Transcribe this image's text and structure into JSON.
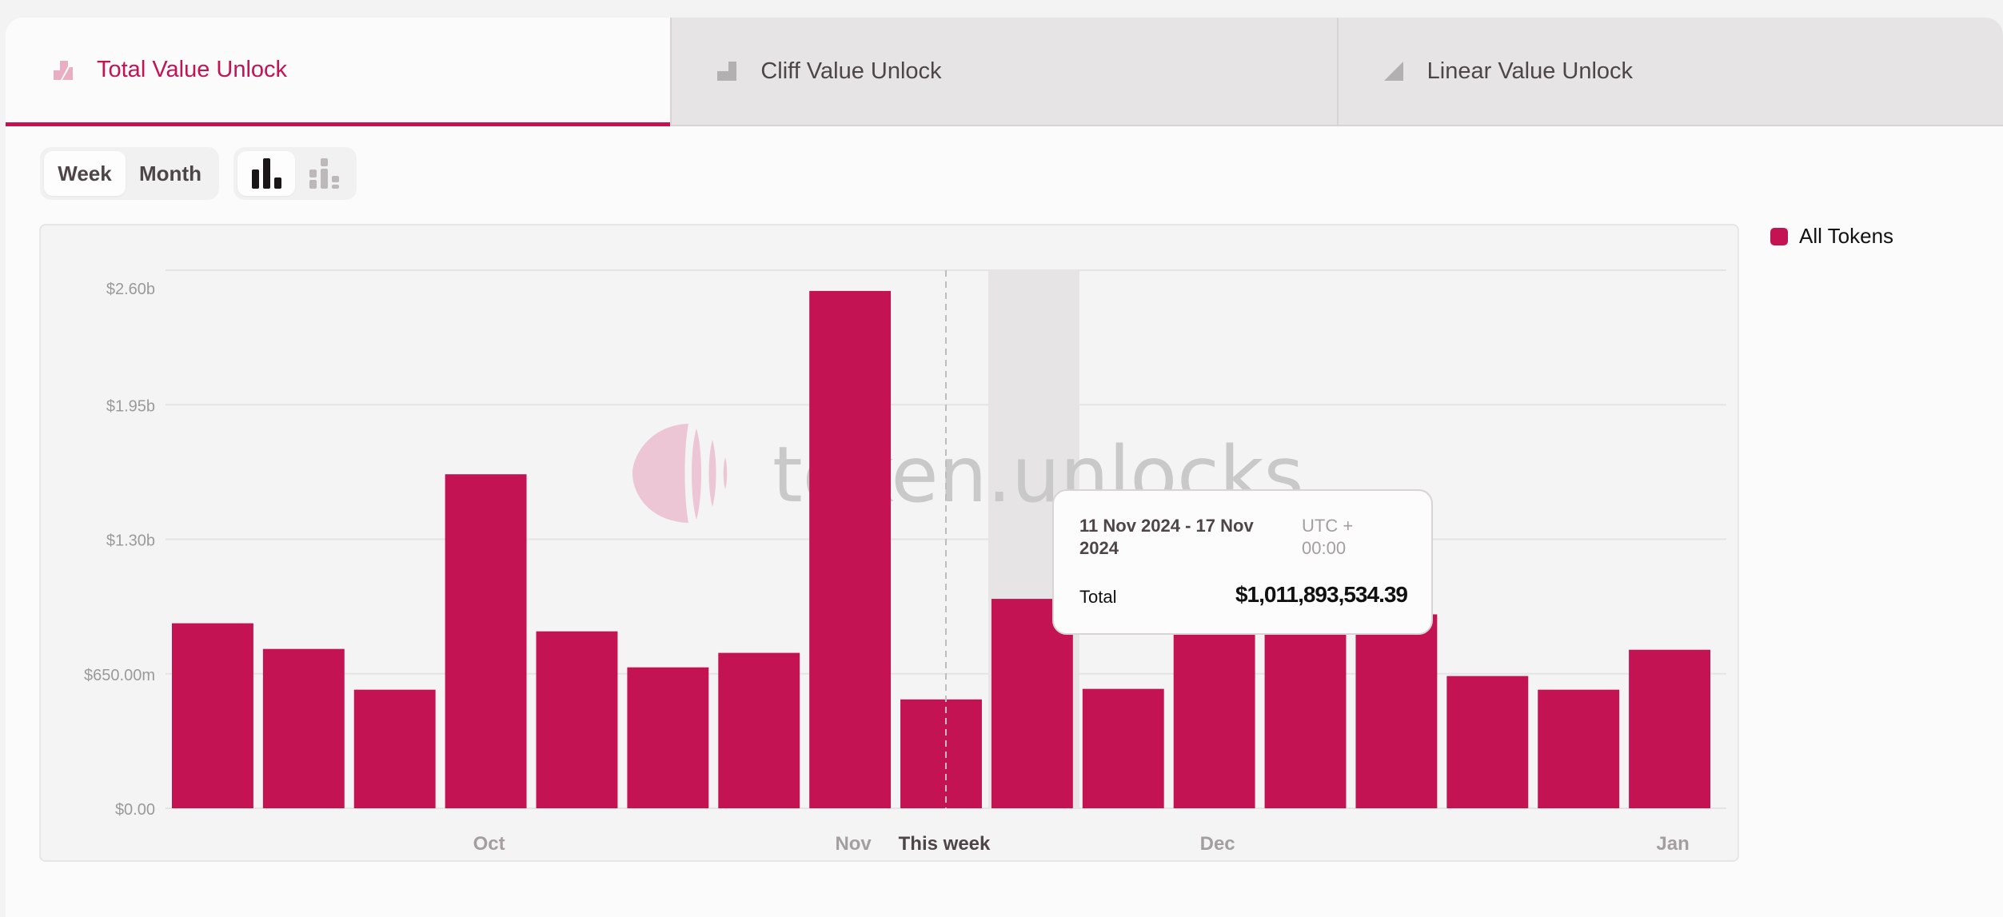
{
  "tabs": [
    {
      "label": "Total Value Unlock",
      "icon": "total-unlock-icon",
      "active": true
    },
    {
      "label": "Cliff Value Unlock",
      "icon": "cliff-unlock-icon",
      "active": false
    },
    {
      "label": "Linear Value Unlock",
      "icon": "linear-unlock-icon",
      "active": false
    }
  ],
  "controls": {
    "period": {
      "options": [
        "Week",
        "Month"
      ],
      "selected": "Week"
    },
    "chart_mode": {
      "options": [
        "bar-chart-icon",
        "stacked-bar-chart-icon"
      ],
      "selected": "bar-chart-icon"
    }
  },
  "colors": {
    "accent": "#c41352",
    "highlight_band": "#e6e4e5",
    "axis_text": "#9a9a9a",
    "month_text": "#a49ea1",
    "current_text": "#4e4548"
  },
  "watermark": "token.unlocks",
  "legend": [
    {
      "label": "All Tokens",
      "color": "#c41352"
    }
  ],
  "tooltip": {
    "date_range": "11 Nov 2024 - 17 Nov 2024",
    "timezone": "UTC + 00:00",
    "label": "Total",
    "value": "$1,011,893,534.39"
  },
  "chart_data": {
    "type": "bar",
    "title": "",
    "xlabel": "",
    "ylabel": "",
    "ylim": [
      0,
      2600000000
    ],
    "y_ticks": [
      {
        "value": 0,
        "label": "$0.00"
      },
      {
        "value": 650000000,
        "label": "$650.00m"
      },
      {
        "value": 1300000000,
        "label": "$1.30b"
      },
      {
        "value": 1950000000,
        "label": "$1.95b"
      },
      {
        "value": 2600000000,
        "label": "$2.60b"
      }
    ],
    "grid": true,
    "legend_position": "right",
    "series": [
      {
        "name": "All Tokens",
        "color": "#c41352",
        "values": [
          894000000,
          770000000,
          573000000,
          1614000000,
          855000000,
          681000000,
          751000000,
          2500000000,
          526000000,
          1011893534.39,
          577000000,
          940000000,
          940000000,
          937000000,
          639000000,
          573000000,
          766000000
        ]
      }
    ],
    "x_labels": [
      {
        "index": 3.5,
        "label": "Oct"
      },
      {
        "index": 7.5,
        "label": "Nov"
      },
      {
        "index": 8.5,
        "label": "This week",
        "current": true
      },
      {
        "index": 11.5,
        "label": "Dec"
      },
      {
        "index": 16.5,
        "label": "Jan"
      }
    ],
    "current_week_index": 8.5,
    "highlighted_index": 9
  }
}
